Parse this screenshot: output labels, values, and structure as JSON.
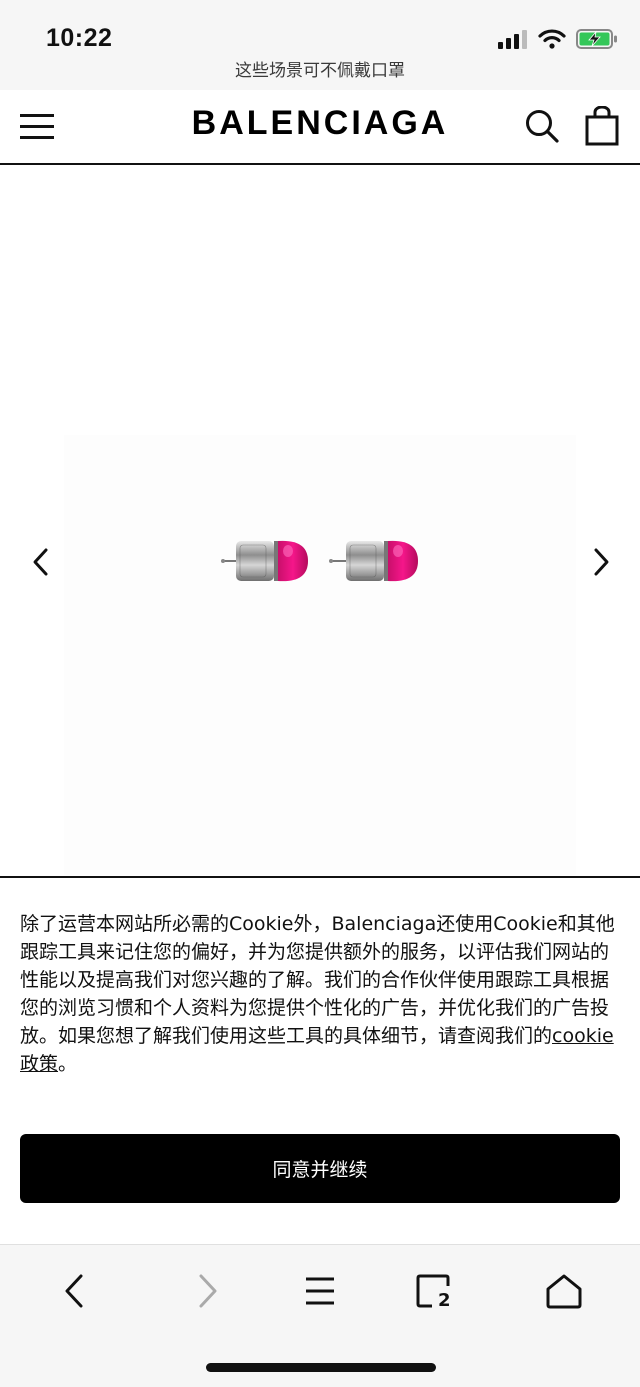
{
  "status_bar": {
    "time": "10:22",
    "subtitle": "这些场景可不佩戴口罩",
    "icons": [
      "signal-icon",
      "wifi-icon",
      "battery-charging-icon"
    ]
  },
  "header": {
    "brand": "BALENCIAGA",
    "icons": [
      "menu-icon",
      "search-icon",
      "shopping-bag-icon"
    ]
  },
  "gallery": {
    "image_description_icon": "earrings-image",
    "nav": [
      "chevron-left-icon",
      "chevron-right-icon"
    ]
  },
  "cookie": {
    "text_before": "除了运营本网站所必需的Cookie外，Balenciaga还使用Cookie和其他跟踪工具来记住您的偏好，并为您提供额外的服务，以评估我们网站的性能以及提高我们对您兴趣的了解。我们的合作伙伴使用跟踪工具根据您的浏览习惯和个人资料为您提供个性化的广告，并优化我们的广告投放。如果您想了解我们使用这些工具的具体细节，请查阅我们的",
    "link_text": "cookie政策",
    "text_after": "。",
    "accept_label": "同意并继续"
  },
  "browser_toolbar": {
    "tabs_count": "2",
    "icons": [
      "back-icon",
      "forward-icon",
      "menu-lines-icon",
      "tabs-icon",
      "home-icon"
    ]
  },
  "colors": {
    "accent": "#000000",
    "background": "#ffffff",
    "earring_pink": "#e8127f",
    "battery_green": "#34c759"
  }
}
